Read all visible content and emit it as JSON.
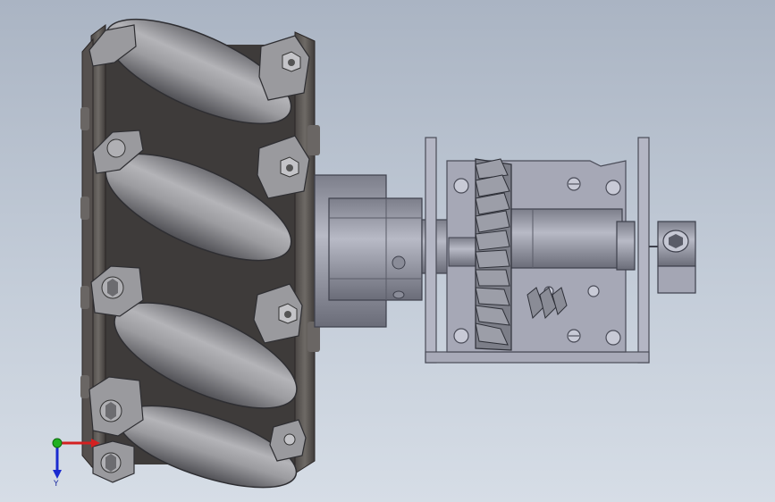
{
  "colors": {
    "background_top": "#aab4c3",
    "background_bottom": "#d6dde6",
    "roller": "#9a9a9e",
    "plate": "#5e5a58",
    "metal": "#a6a8b4",
    "gear": "#8e8e94",
    "axis_x": "#d42020",
    "axis_y": "#1a2ad0",
    "axis_origin": "#20b020"
  },
  "triad": {
    "y_label": "Y"
  }
}
